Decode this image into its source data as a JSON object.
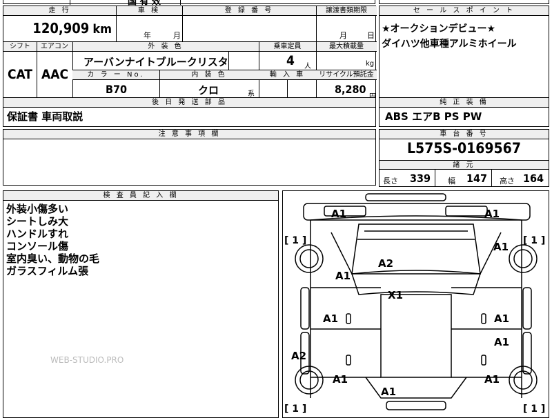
{
  "header_top": {
    "partial_label": "国 有 效"
  },
  "mileage": {
    "label": "走 行",
    "value": "120,909",
    "unit": "km"
  },
  "inspection": {
    "label": "車 検",
    "year_unit": "年",
    "month_unit": "月"
  },
  "registration": {
    "label": "登 録 番 号"
  },
  "transfer_deadline": {
    "label": "譲渡書類期限",
    "month_unit": "月",
    "day_unit": "日"
  },
  "shift": {
    "label": "シフト",
    "value": "CAT"
  },
  "aircon": {
    "label": "エアコン",
    "value": "AAC"
  },
  "exterior_color": {
    "label": "外 装 色",
    "value": "アーバンナイトブルークリスタ"
  },
  "capacity": {
    "label": "乗車定員",
    "value": "4",
    "unit": "人"
  },
  "max_load": {
    "label": "最大積載量",
    "unit": "kg"
  },
  "color_no": {
    "label": "カ ラ ー No.",
    "value": "B70"
  },
  "interior_color": {
    "label": "内 装 色",
    "value": "クロ",
    "suffix": "系"
  },
  "import": {
    "label": "輸 入 車"
  },
  "recycle": {
    "label": "リサイクル預託金",
    "value": "8,280",
    "unit": "円"
  },
  "later_parts": {
    "label": "後 日 発 送 部 品",
    "value": "保証書 車両取説"
  },
  "sales_point": {
    "label": "セ ー ル ス ポ イ ン ト",
    "lines": [
      "★オークションデビュー★",
      "ダイハツ他車種アルミホイール"
    ]
  },
  "equipment": {
    "label": "純 正 装 備",
    "value": "ABS エアB PS PW"
  },
  "notes": {
    "label": "注 意 事 項 欄"
  },
  "chassis": {
    "label": "車 台 番 号",
    "value": "L575S-0169567"
  },
  "dimensions": {
    "label": "諸 元",
    "length_label": "長さ",
    "length": "339",
    "width_label": "幅",
    "width": "147",
    "height_label": "高さ",
    "height": "164"
  },
  "inspector": {
    "label": "検 査 員 記 入 欄",
    "lines": [
      "外装小傷多い",
      "シートしみ大",
      "ハンドルすれ",
      "コンソール傷",
      "室内臭い、動物の毛",
      "ガラスフィルム張"
    ]
  },
  "watermark": "WEB-STUDIO.PRO",
  "damage_marks": {
    "front_left": "A1",
    "front_right": "A1",
    "fender_left": "A1",
    "fender_right": "A1",
    "hood": "A2",
    "roof": "X1",
    "door_left_front": "A1",
    "door_right_front": "A1",
    "door_right_rear": "A1",
    "rear_left_quarter": "A2",
    "rear_left": "A1",
    "rear_center": "A1",
    "rear_right": "A1",
    "tire_front_left": "1",
    "tire_front_right": "1",
    "tire_rear_left": "1",
    "tire_rear_right": "1"
  }
}
